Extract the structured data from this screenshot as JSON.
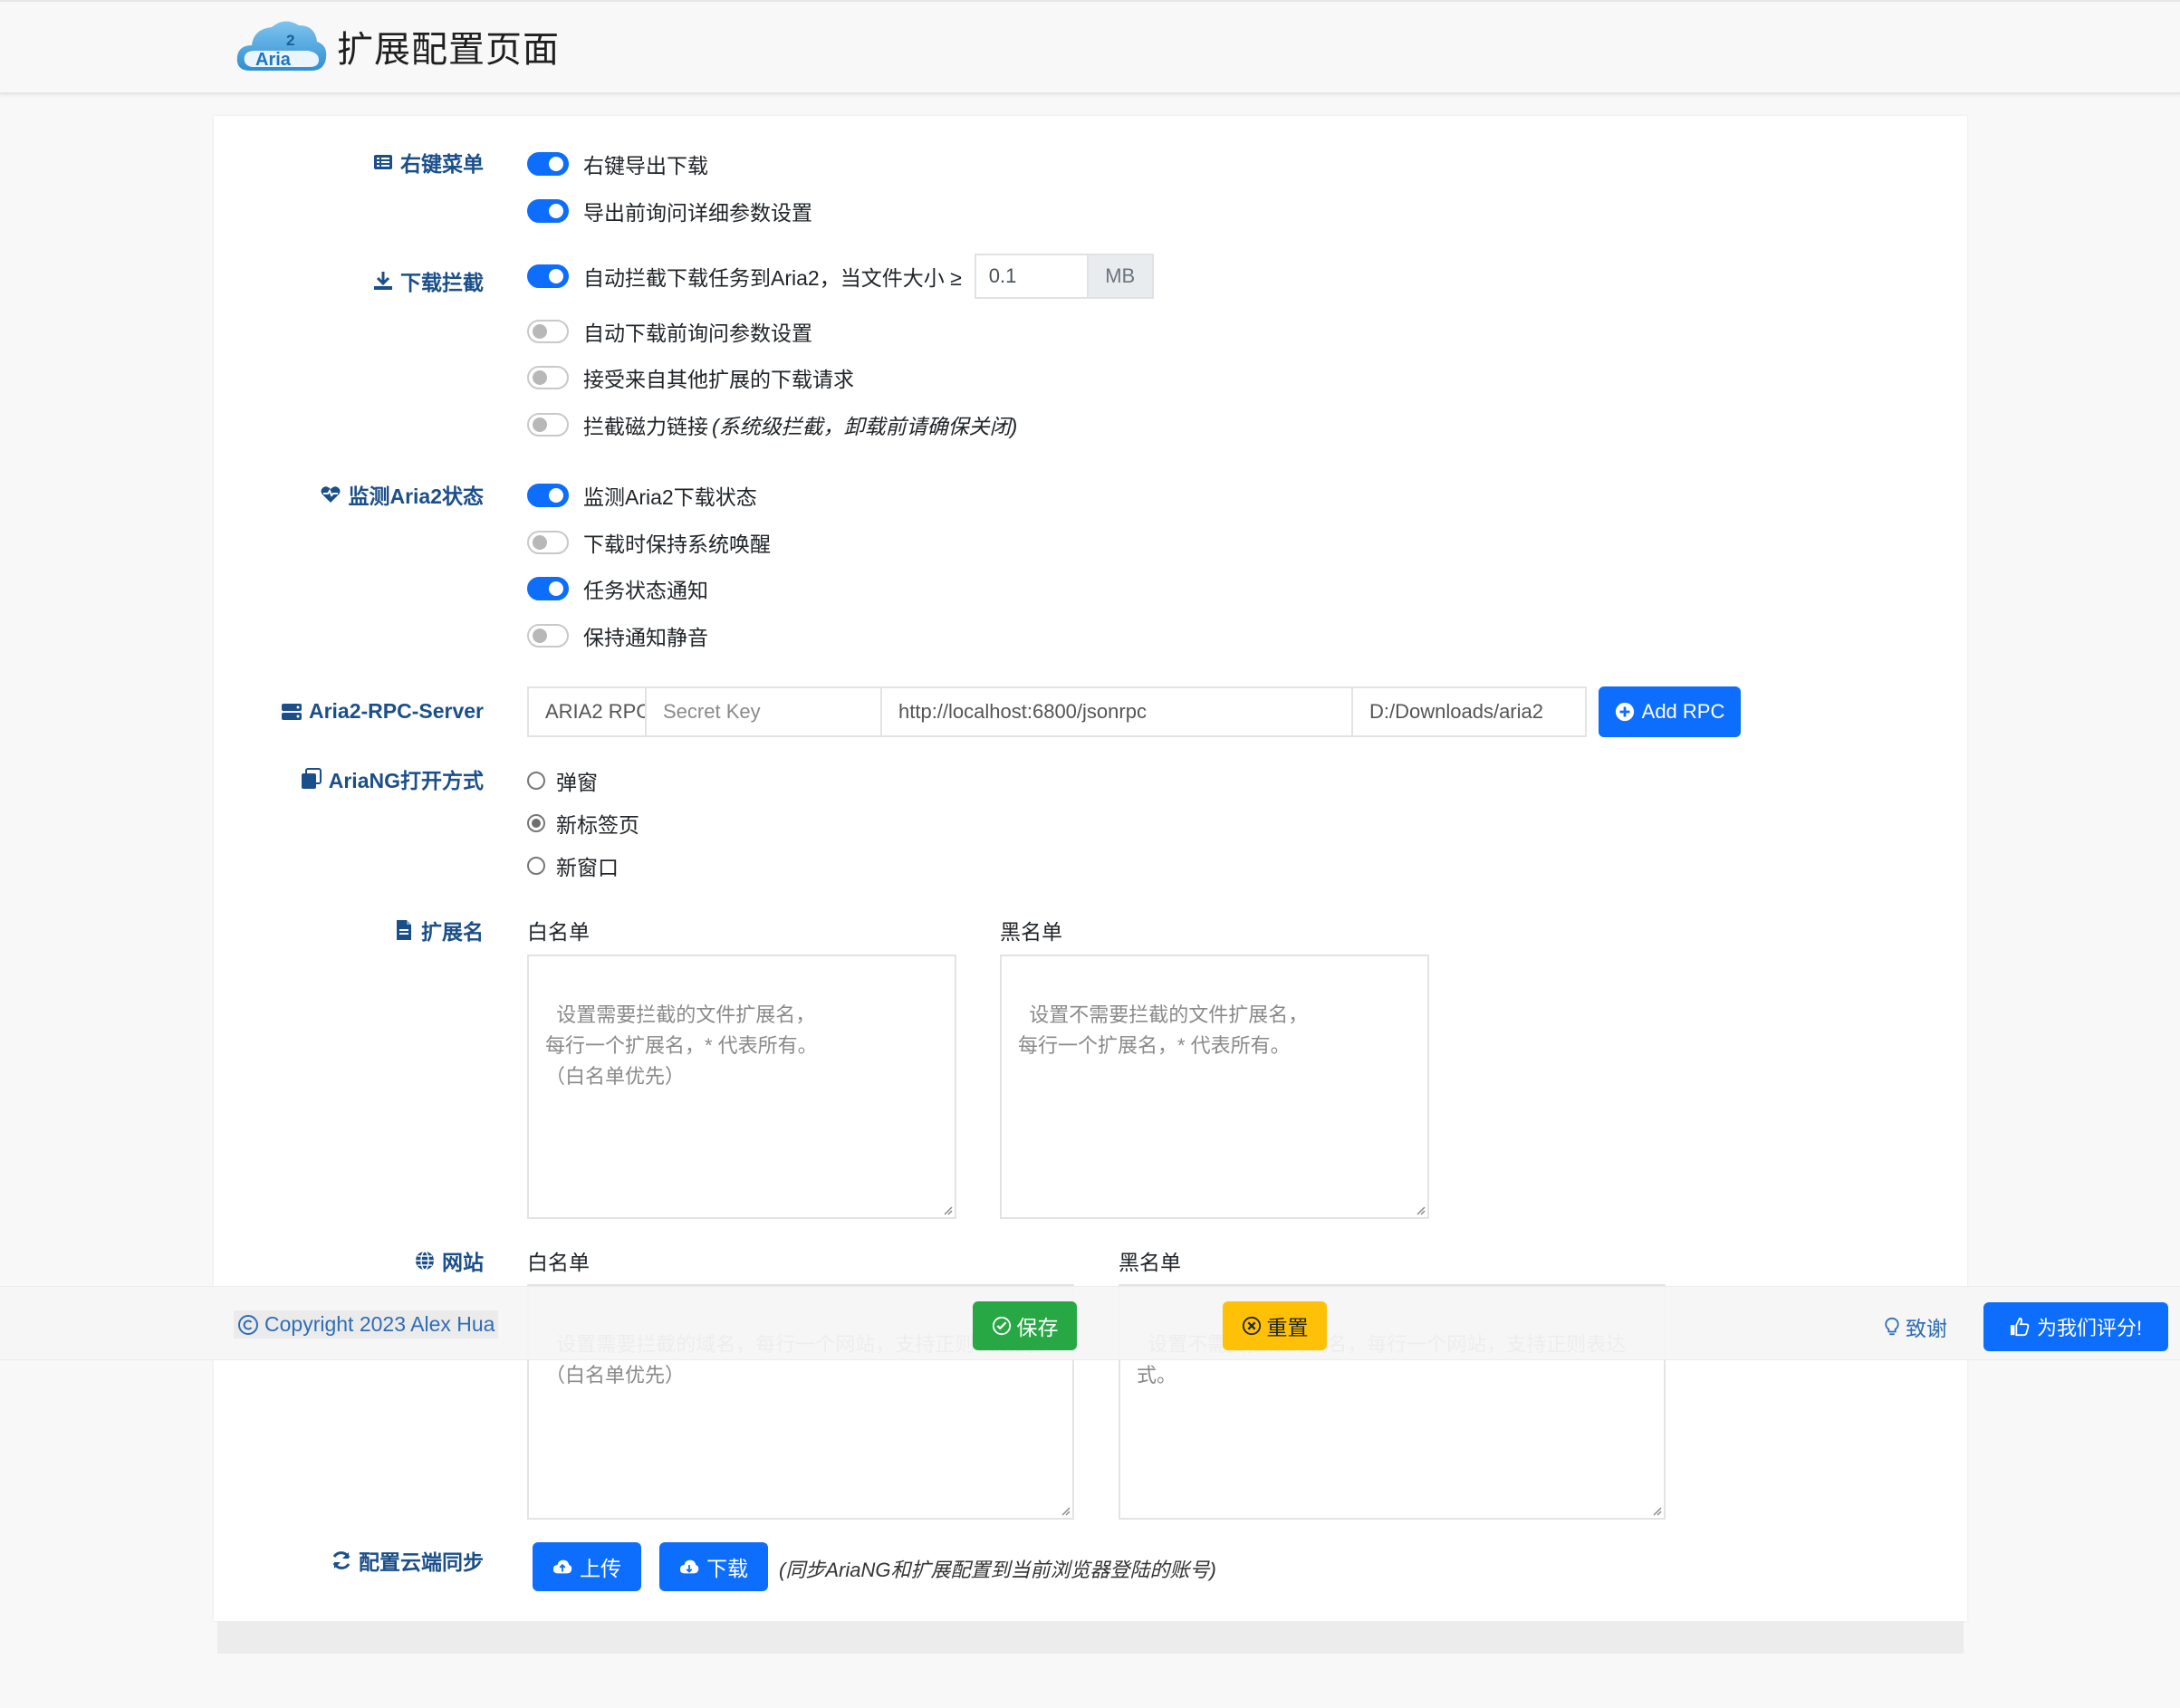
{
  "header": {
    "logo_text": "Aria",
    "logo_superscript": "2",
    "title": "扩展配置页面"
  },
  "sections": {
    "context_menu": {
      "label": "右键菜单",
      "icon": "list-icon",
      "options": [
        {
          "label": "右键导出下载",
          "enabled": true
        },
        {
          "label": "导出前询问详细参数设置",
          "enabled": true
        }
      ]
    },
    "download_intercept": {
      "label": "下载拦截",
      "icon": "download-icon",
      "options": [
        {
          "label": "自动拦截下载任务到Aria2，当文件大小 ≥",
          "enabled": true
        },
        {
          "label": "自动下载前询问参数设置",
          "enabled": false
        },
        {
          "label": "接受来自其他扩展的下载请求",
          "enabled": false
        },
        {
          "label": "拦截磁力链接",
          "note": "(系统级拦截，卸载前请确保关闭)",
          "enabled": false
        }
      ],
      "file_size_value": "0.1",
      "file_size_unit": "MB"
    },
    "monitor": {
      "label": "监测Aria2状态",
      "icon": "heartbeat-icon",
      "options": [
        {
          "label": "监测Aria2下载状态",
          "enabled": true
        },
        {
          "label": "下载时保持系统唤醒",
          "enabled": false
        },
        {
          "label": "任务状态通知",
          "enabled": true
        },
        {
          "label": "保持通知静音",
          "enabled": false
        }
      ]
    },
    "rpc_server": {
      "label": "Aria2-RPC-Server",
      "icon": "server-icon",
      "name_value": "ARIA2 RPC",
      "secret_placeholder": "Secret Key",
      "url_value": "http://localhost:6800/jsonrpc",
      "dir_value": "D:/Downloads/aria2",
      "add_button": "Add RPC"
    },
    "ariang_open": {
      "label": "AriaNG打开方式",
      "icon": "window-icon",
      "options": [
        {
          "label": "弹窗",
          "checked": false
        },
        {
          "label": "新标签页",
          "checked": true
        },
        {
          "label": "新窗口",
          "checked": false
        }
      ]
    },
    "extensions": {
      "label": "扩展名",
      "icon": "file-icon",
      "whitelist_label": "白名单",
      "blacklist_label": "黑名单",
      "whitelist_placeholder": "设置需要拦截的文件扩展名，\n每行一个扩展名，* 代表所有。\n（白名单优先）",
      "blacklist_placeholder": "设置不需要拦截的文件扩展名，\n每行一个扩展名，* 代表所有。"
    },
    "websites": {
      "label": "网站",
      "icon": "globe-icon",
      "whitelist_label": "白名单",
      "blacklist_label": "黑名单",
      "whitelist_placeholder": "设置需要拦截的域名，每行一个网站，支持正则表达式。\n（白名单优先）",
      "blacklist_placeholder": "设置不需要拦截的域名，每行一个网站，支持正则表达式。"
    },
    "cloud_sync": {
      "label": "配置云端同步",
      "icon": "sync-icon",
      "upload_button": "上传",
      "download_button": "下载",
      "note": "(同步AriaNG和扩展配置到当前浏览器登陆的账号)"
    }
  },
  "footer": {
    "copyright": "Copyright 2023 Alex Hua",
    "save_button": "保存",
    "reset_button": "重置",
    "thanks_link": "致谢",
    "rate_button": "为我们评分!"
  },
  "colors": {
    "primary": "#0d6efd",
    "success": "#28a745",
    "warning": "#ffc107",
    "section_label": "#1b4f8a"
  }
}
